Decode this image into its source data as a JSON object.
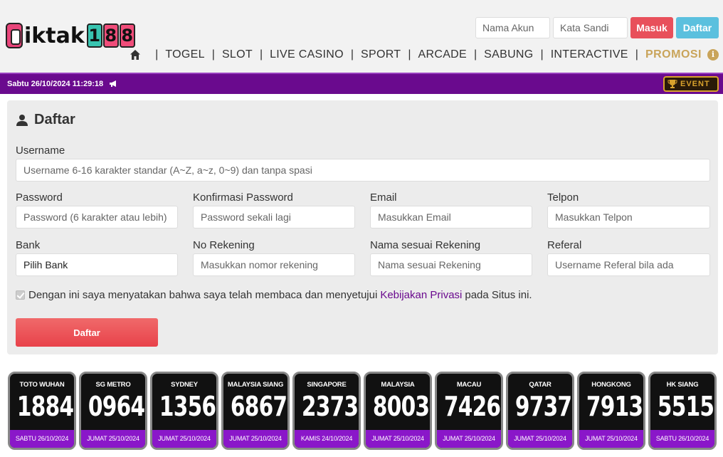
{
  "header": {
    "login": {
      "username_placeholder": "Nama Akun",
      "password_placeholder": "Kata Sandi",
      "login_label": "Masuk",
      "register_label": "Daftar"
    },
    "nav": {
      "home_icon": "home-icon",
      "items": [
        "TOGEL",
        "SLOT",
        "LIVE CASINO",
        "SPORT",
        "ARCADE",
        "SABUNG",
        "INTERACTIVE"
      ],
      "promo_label": "PROMOSI",
      "info_icon": "info-icon",
      "promo_color": "#c9a45a"
    }
  },
  "datebar": {
    "datetime": "Sabtu 26/10/2024 11:29:18",
    "megaphone_icon": "megaphone-icon",
    "event_label": "EVENT",
    "color": "#6a0a8e"
  },
  "form": {
    "title": "Daftar",
    "user_icon": "user-icon",
    "username": {
      "label": "Username",
      "placeholder": "Username 6-16 karakter standar (A~Z, a~z, 0~9) dan tanpa spasi"
    },
    "password": {
      "label": "Password",
      "placeholder": "Password (6 karakter atau lebih)"
    },
    "confirm_password": {
      "label": "Konfirmasi Password",
      "placeholder": "Password sekali lagi"
    },
    "email": {
      "label": "Email",
      "placeholder": "Masukkan Email"
    },
    "phone": {
      "label": "Telpon",
      "placeholder": "Masukkan Telpon"
    },
    "bank": {
      "label": "Bank",
      "value": "Pilih Bank"
    },
    "account_no": {
      "label": "No Rekening",
      "placeholder": "Masukkan nomor rekening"
    },
    "account_name": {
      "label": "Nama sesuai Rekening",
      "placeholder": "Nama sesuai Rekening"
    },
    "referral": {
      "label": "Referal",
      "placeholder": "Username Referal bila ada"
    },
    "agree": {
      "text_before": "Dengan ini saya menyatakan bahwa saya telah membaca dan menyetujui",
      "link": "Kebijakan Privasi",
      "text_after": "pada Situs ini.",
      "checked": true
    },
    "submit_label": "Daftar"
  },
  "results": [
    {
      "market": "TOTO WUHAN",
      "number": "1884",
      "date": "SABTU 26/10/2024"
    },
    {
      "market": "SG METRO",
      "number": "0964",
      "date": "JUMAT 25/10/2024"
    },
    {
      "market": "SYDNEY",
      "number": "1356",
      "date": "JUMAT 25/10/2024"
    },
    {
      "market": "MALAYSIA SIANG",
      "number": "6867",
      "date": "JUMAT 25/10/2024"
    },
    {
      "market": "SINGAPORE",
      "number": "2373",
      "date": "KAMIS 24/10/2024"
    },
    {
      "market": "MALAYSIA",
      "number": "8003",
      "date": "JUMAT 25/10/2024"
    },
    {
      "market": "MACAU",
      "number": "7426",
      "date": "JUMAT 25/10/2024"
    },
    {
      "market": "QATAR",
      "number": "9737",
      "date": "JUMAT 25/10/2024"
    },
    {
      "market": "HONGKONG",
      "number": "7913",
      "date": "JUMAT 25/10/2024"
    },
    {
      "market": "HK SIANG",
      "number": "5515",
      "date": "SABTU 26/10/2024"
    }
  ]
}
